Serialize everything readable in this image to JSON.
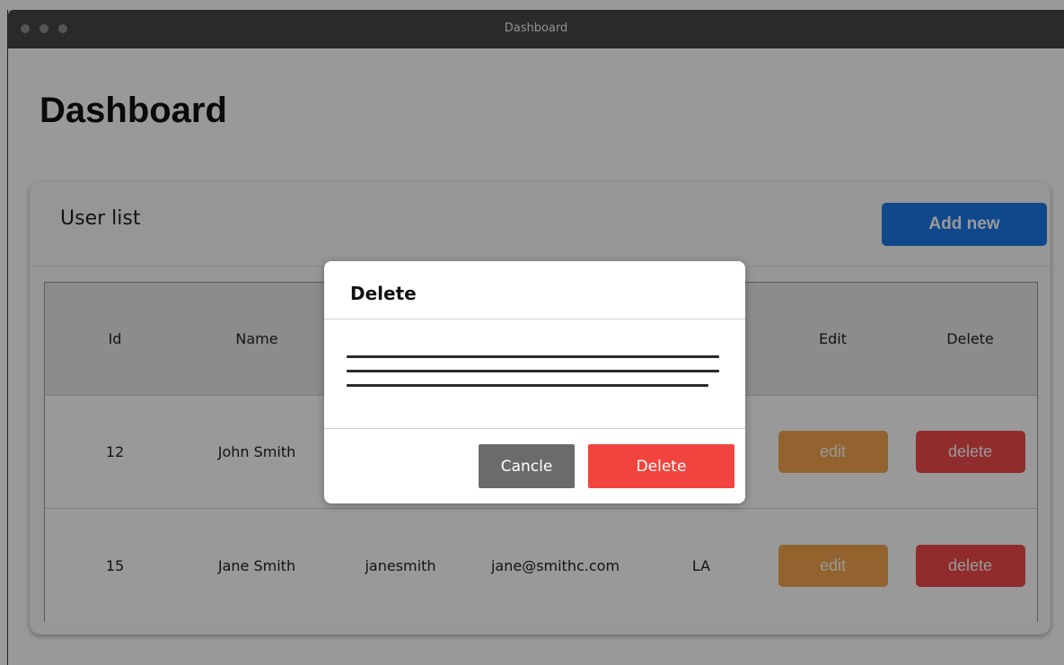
{
  "window": {
    "title": "Dashboard"
  },
  "page": {
    "title": "Dashboard"
  },
  "user_list": {
    "title": "User list",
    "add_button": "Add new",
    "columns": {
      "id": "Id",
      "name": "Name",
      "edit": "Edit",
      "delete": "Delete"
    },
    "rows": [
      {
        "id": "12",
        "name": "John Smith",
        "edit_label": "edit",
        "delete_label": "delete"
      },
      {
        "id": "15",
        "name": "Jane Smith",
        "username": "janesmith",
        "email": "jane@smithc.com",
        "city": "LA",
        "edit_label": "edit",
        "delete_label": "delete"
      }
    ]
  },
  "modal": {
    "title": "Delete",
    "cancel_label": "Cancle",
    "confirm_label": "Delete"
  },
  "colors": {
    "primary": "#1b7ae8",
    "edit": "#f3a64e",
    "delete": "#f04a4a",
    "cancel": "#6b6b6b",
    "overlay": "rgba(0,0,0,0.40)"
  }
}
